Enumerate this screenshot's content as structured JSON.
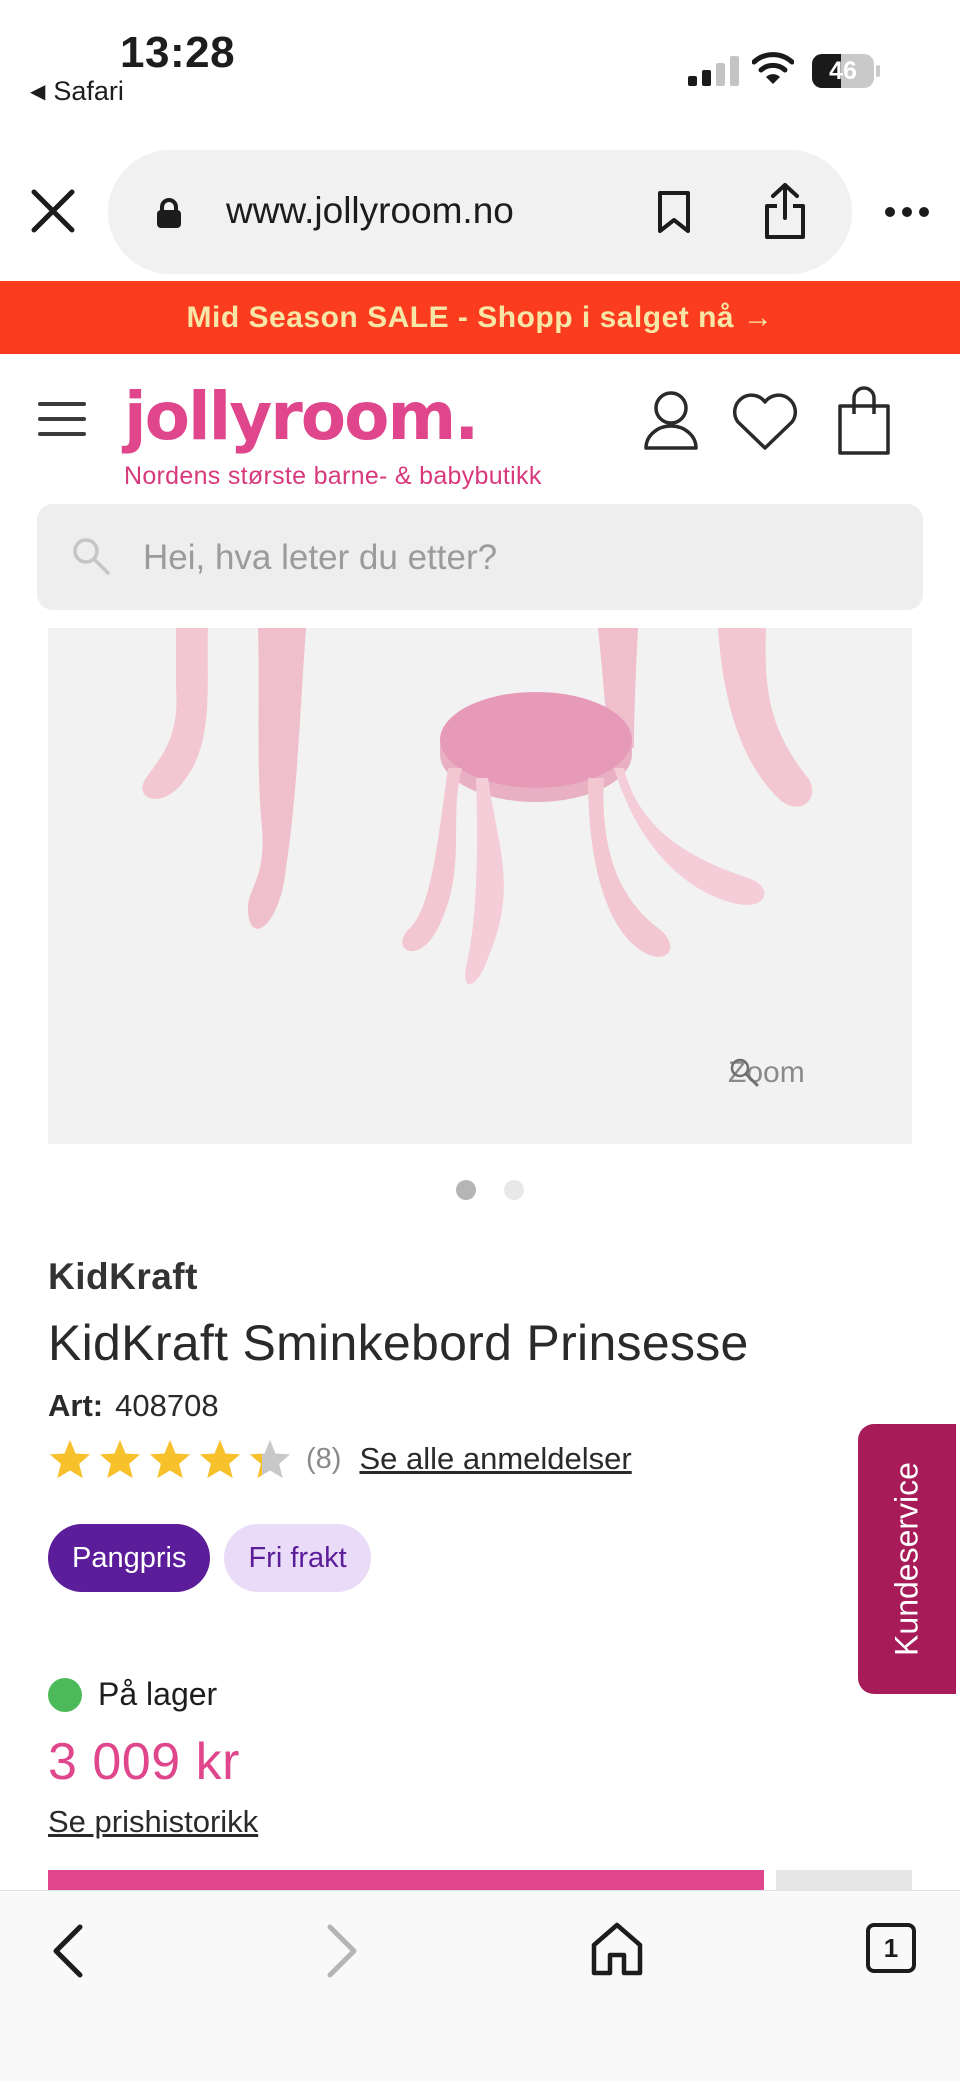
{
  "status_bar": {
    "time": "13:28",
    "back_app": "Safari",
    "battery_level": "46",
    "battery_fraction": 0.46
  },
  "browser": {
    "url": "www.jollyroom.no"
  },
  "promo": {
    "text": "Mid Season SALE - Shopp i salget nå →"
  },
  "header": {
    "logo": "jollyroom.",
    "tagline": "Nordens største barne- & babybutikk"
  },
  "search": {
    "placeholder": "Hei, hva leter du etter?"
  },
  "gallery": {
    "zoom_label": "Zoom",
    "image_count": 2,
    "active_index": 0
  },
  "product": {
    "brand": "KidKraft",
    "title": "KidKraft Sminkebord Prinsesse",
    "art_label": "Art:",
    "art_number": "408708",
    "rating": 4,
    "rating_max": 5,
    "review_count": "(8)",
    "see_reviews": "Se alle anmeldelser",
    "badges": [
      "Pangpris",
      "Fri frakt"
    ],
    "stock": "På lager",
    "price": "3 009 kr",
    "price_history": "Se prishistorikk"
  },
  "side_tab": {
    "label": "Kundeservice"
  },
  "toolbar": {
    "tab_count": "1"
  },
  "colors": {
    "promo_bg": "#fb3c1e",
    "brand_pink": "#e0468b",
    "badge_purple": "#5b1d9a",
    "service_tab": "#a71b58",
    "stock_green": "#4cba5a"
  },
  "icons": {
    "close": "close-icon",
    "lock": "lock-icon",
    "bookmark": "bookmark-icon",
    "share": "share-icon",
    "more": "more-icon",
    "menu": "hamburger-icon",
    "account": "user-icon",
    "wishlist": "heart-icon",
    "cart": "bag-icon",
    "search": "search-icon",
    "zoom": "magnifier-icon"
  }
}
